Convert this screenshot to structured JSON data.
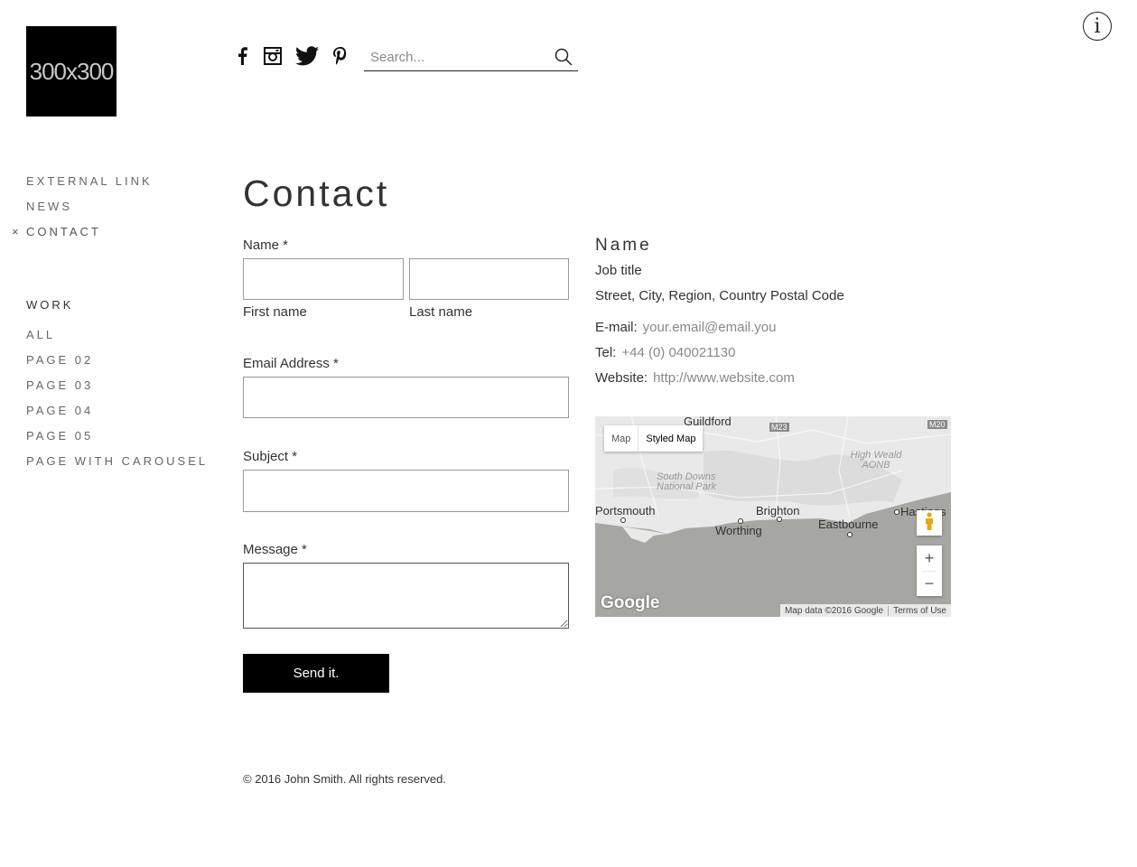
{
  "logo": {
    "text": "300x300"
  },
  "social": [
    "facebook-icon",
    "instagram-icon",
    "twitter-icon",
    "pinterest-icon"
  ],
  "search": {
    "placeholder": "Search..."
  },
  "nav": {
    "primary": [
      {
        "label": "EXTERNAL LINK"
      },
      {
        "label": "NEWS"
      },
      {
        "label": "CONTACT",
        "current": true,
        "marker": "×"
      }
    ],
    "work_heading": "WORK",
    "work": [
      {
        "label": "ALL"
      },
      {
        "label": "PAGE 02"
      },
      {
        "label": "PAGE 03"
      },
      {
        "label": "PAGE 04"
      },
      {
        "label": "PAGE 05"
      },
      {
        "label": "PAGE WITH CAROUSEL"
      }
    ]
  },
  "page": {
    "title": "Contact"
  },
  "form": {
    "name_label": "Name *",
    "first_name_label": "First name",
    "last_name_label": "Last name",
    "first_name_value": "",
    "last_name_value": "",
    "email_label": "Email Address *",
    "email_value": "",
    "subject_label": "Subject *",
    "subject_value": "",
    "message_label": "Message *",
    "message_value": "",
    "submit_label": "Send it."
  },
  "contact": {
    "name": "Name",
    "job_title": "Job title",
    "address": "Street, City, Region, Country Postal Code",
    "email_label": "E-mail:",
    "email_value": "your.email@email.you",
    "tel_label": "Tel:",
    "tel_value": "+44 (0) 040021130",
    "website_label": "Website:",
    "website_value": "http://www.website.com"
  },
  "map": {
    "type_options": [
      "Map",
      "Styled Map"
    ],
    "selected_type": "Styled Map",
    "places": [
      "Guildford",
      "Portsmouth",
      "Brighton",
      "Worthing",
      "Eastbourne",
      "Hastings"
    ],
    "parks": [
      "South Downs National Park",
      "High Weald AONB"
    ],
    "motorways": [
      "M23",
      "M20"
    ],
    "zoom_in": "+",
    "zoom_out": "−",
    "logo": "Google",
    "attribution": "Map data ©2016 Google",
    "terms": "Terms of Use",
    "colors": {
      "land": "#e9e9e9",
      "sea": "#a6a6a3"
    }
  },
  "footer": {
    "text": "© 2016 John Smith. All rights reserved."
  }
}
